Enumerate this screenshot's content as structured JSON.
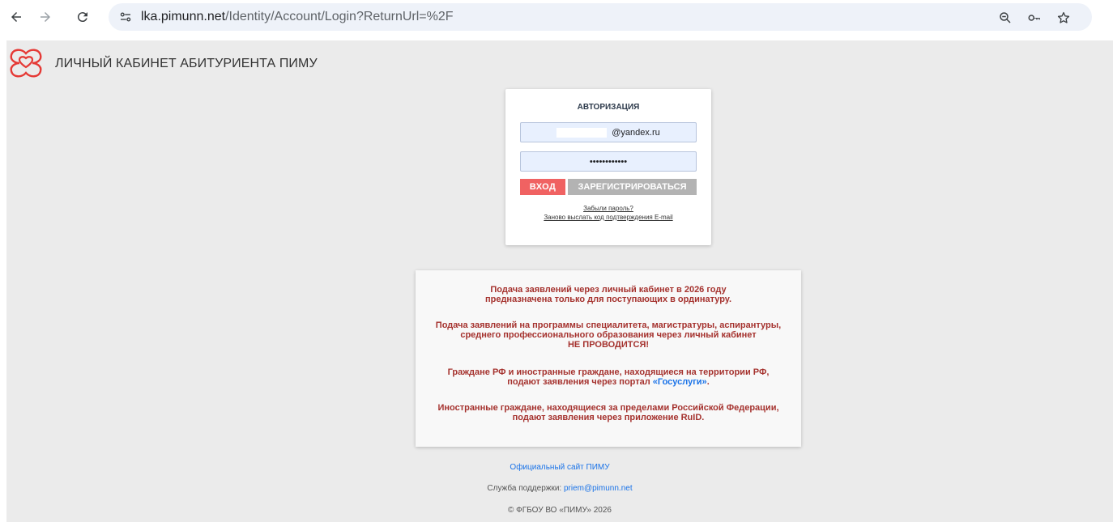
{
  "browser": {
    "url_host": "lka.pimunn.net",
    "url_path": "/Identity/Account/Login?ReturnUrl=%2F",
    "icons": [
      "back-icon",
      "forward-icon",
      "reload-icon",
      "site-settings-icon",
      "zoom-icon",
      "password-key-icon",
      "bookmark-star-icon"
    ]
  },
  "header": {
    "title": "ЛИЧНЫЙ КАБИНЕТ АБИТУРИЕНТА ПИМУ",
    "logo_color": "#e53935"
  },
  "auth": {
    "title": "АВТОРИЗАЦИЯ",
    "email_value": "@yandex.ru",
    "password_value": "••••••••••••",
    "login_label": "ВХОД",
    "register_label": "ЗАРЕГИСТРИРОВАТЬСЯ",
    "forgot_label": "Забыли пароль?",
    "resend_label": "Заново выслать код подтверждения E-mail"
  },
  "notice": {
    "p1_line1": "Подача заявлений через личный кабинет в 2026 году",
    "p1_line2": "предназначена только для поступающих в ординатуру.",
    "p2_line1": "Подача заявлений на программы специалитета, магистратуры, аспирантуры,",
    "p2_line2": "среднего профессионального образования через личный кабинет",
    "p2_line3": "НЕ ПРОВОДИТСЯ!",
    "p3_line1": "Граждане РФ и иностранные граждане, находящиеся на территории РФ,",
    "p3_line2_pre": "подают заявления через портал",
    "p3_link": "«Госуслуги»",
    "p3_line2_post": ".",
    "p4_line1": "Иностранные граждане, находящиеся за пределами Российской Федерации,",
    "p4_line2": "подают заявления через приложение RuID.",
    "text_color": "#a5322e"
  },
  "footer": {
    "official_site": "Официальный сайт ПИМУ",
    "support_label": "Служба поддержки:",
    "support_email": "priem@pimunn.net",
    "copyright": "© ФГБОУ ВО «ПИМУ» 2026"
  }
}
